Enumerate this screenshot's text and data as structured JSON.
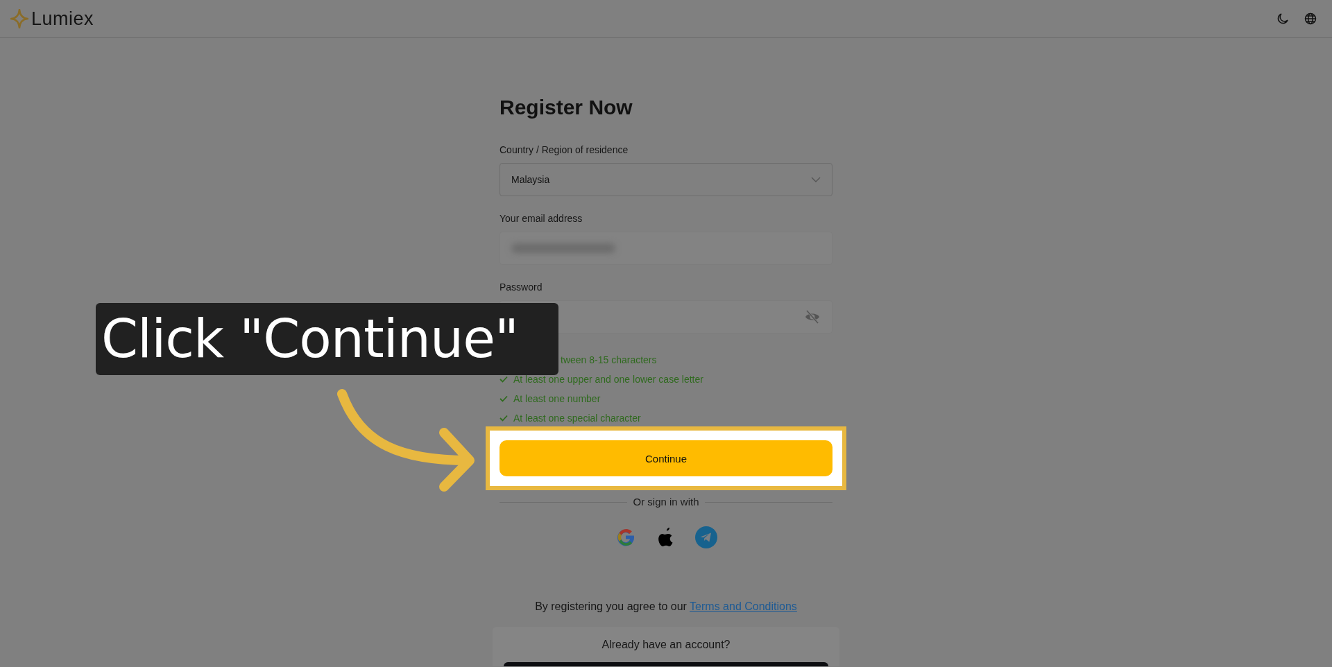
{
  "header": {
    "logo": "Lumiex"
  },
  "form": {
    "title": "Register Now",
    "fields": [
      {
        "kind": "select",
        "label": "Country / Region of residence",
        "value": "Malaysia"
      },
      {
        "kind": "redacted",
        "label": "Your email address"
      },
      {
        "kind": "password",
        "label": "Password"
      }
    ],
    "requirements": [
      {
        "text": "tween 8-15 characters"
      },
      {
        "text": "At least one upper and one lower case letter",
        "checked": true
      },
      {
        "text": "At least one number",
        "checked": true
      },
      {
        "text": "At least one special character",
        "checked": true
      }
    ],
    "continue_button": "Continue",
    "divider": "Or sign in with",
    "social": [
      {
        "kind": "google"
      },
      {
        "kind": "apple"
      },
      {
        "kind": "telegram"
      }
    ],
    "terms": {
      "text": "By registering you agree to our ",
      "link": "Terms and Conditions"
    },
    "login_box": {
      "question": "Already have an account?"
    }
  },
  "callout": {
    "text": "Click \"Continue\""
  }
}
